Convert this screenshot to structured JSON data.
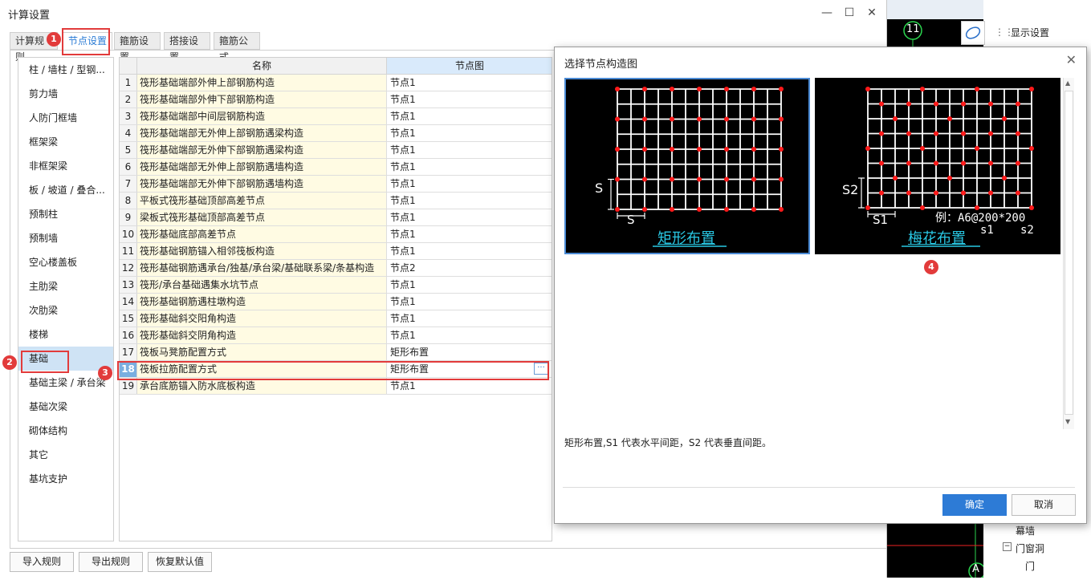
{
  "window": {
    "title": "计算设置"
  },
  "tabs": [
    "计算规则",
    "节点设置",
    "箍筋设置",
    "搭接设置",
    "箍筋公式"
  ],
  "sidebar": [
    "柱 / 墙柱 / 型钢...",
    "剪力墙",
    "人防门框墙",
    "框架梁",
    "非框架梁",
    "板 / 坡道 / 叠合...",
    "预制柱",
    "预制墙",
    "空心楼盖板",
    "主肋梁",
    "次肋梁",
    "楼梯",
    "基础",
    "基础主梁 / 承台梁",
    "基础次梁",
    "砌体结构",
    "其它",
    "基坑支护"
  ],
  "grid": {
    "headers": [
      "名称",
      "节点图"
    ],
    "rows": [
      {
        "no": "1",
        "name": "筏形基础端部外伸上部钢筋构造",
        "node": "节点1"
      },
      {
        "no": "2",
        "name": "筏形基础端部外伸下部钢筋构造",
        "node": "节点1"
      },
      {
        "no": "3",
        "name": "筏形基础端部中间层钢筋构造",
        "node": "节点1"
      },
      {
        "no": "4",
        "name": "筏形基础端部无外伸上部钢筋遇梁构造",
        "node": "节点1"
      },
      {
        "no": "5",
        "name": "筏形基础端部无外伸下部钢筋遇梁构造",
        "node": "节点1"
      },
      {
        "no": "6",
        "name": "筏形基础端部无外伸上部钢筋遇墙构造",
        "node": "节点1"
      },
      {
        "no": "7",
        "name": "筏形基础端部无外伸下部钢筋遇墙构造",
        "node": "节点1"
      },
      {
        "no": "8",
        "name": "平板式筏形基础顶部高差节点",
        "node": "节点1"
      },
      {
        "no": "9",
        "name": "梁板式筏形基础顶部高差节点",
        "node": "节点1"
      },
      {
        "no": "10",
        "name": "筏形基础底部高差节点",
        "node": "节点1"
      },
      {
        "no": "11",
        "name": "筏形基础钢筋锚入相邻筏板构造",
        "node": "节点1"
      },
      {
        "no": "12",
        "name": "筏形基础钢筋遇承台/独基/承台梁/基础联系梁/条基构造",
        "node": "节点2"
      },
      {
        "no": "13",
        "name": "筏形/承台基础遇集水坑节点",
        "node": "节点1"
      },
      {
        "no": "14",
        "name": "筏形基础钢筋遇柱墩构造",
        "node": "节点1"
      },
      {
        "no": "15",
        "name": "筏形基础斜交阳角构造",
        "node": "节点1"
      },
      {
        "no": "16",
        "name": "筏形基础斜交阴角构造",
        "node": "节点1"
      },
      {
        "no": "17",
        "name": "筏板马凳筋配置方式",
        "node": "矩形布置"
      },
      {
        "no": "18",
        "name": "筏板拉筋配置方式",
        "node": "矩形布置"
      },
      {
        "no": "19",
        "name": "承台底筋锚入防水底板构造",
        "node": "节点1"
      }
    ],
    "ellipsis": "···"
  },
  "badges": [
    "1",
    "2",
    "3",
    "4"
  ],
  "buttons": {
    "import": "导入规则",
    "export": "导出规则",
    "restore": "恢复默认值"
  },
  "dialog": {
    "title": "选择节点构造图",
    "options": [
      {
        "caption": "矩形布置",
        "dim_v": "S",
        "dim_h": "S"
      },
      {
        "caption": "梅花布置",
        "dim_v": "S2",
        "dim_h": "S1",
        "example": "例：A6@200*200",
        "s1": "s1",
        "s2": "s2"
      }
    ],
    "description": "矩形布置,S1 代表水平间距，S2 代表垂直间距。",
    "ok": "确定",
    "cancel": "取消"
  },
  "right_panel": {
    "display_settings": "显示设置",
    "axis_top": "11",
    "axis_bottom": "A",
    "tree": [
      "幕墙",
      "门窗洞",
      "门"
    ]
  }
}
